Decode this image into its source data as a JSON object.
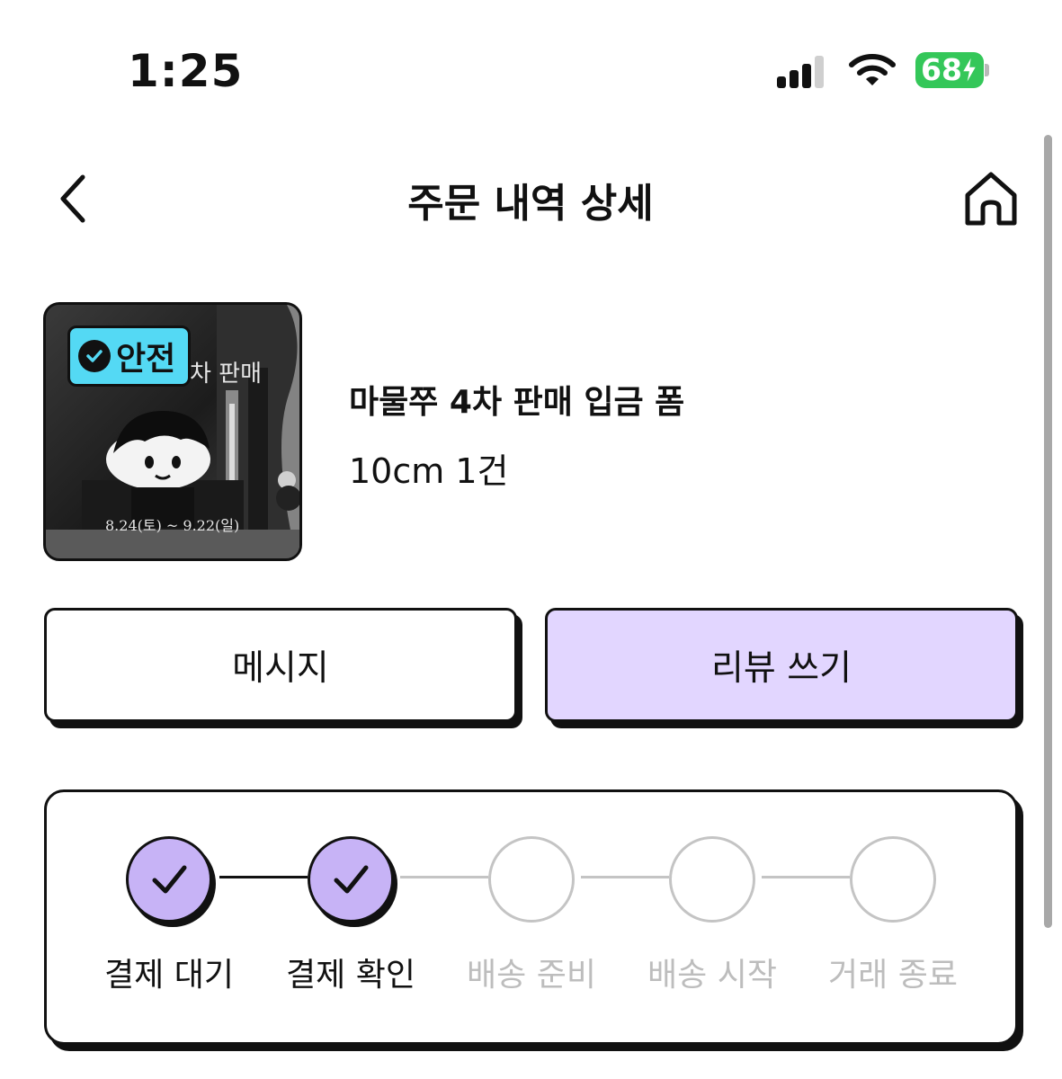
{
  "status_bar": {
    "time": "1:25",
    "battery_level": "68"
  },
  "header": {
    "title": "주문 내역 상세"
  },
  "product": {
    "badge": "안전",
    "image_text_top": "차 판매",
    "image_text_bottom": "8.24(토) ~ 9.22(일)",
    "title": "마물쭈 4차 판매 입금 폼",
    "option": "10cm 1건"
  },
  "actions": {
    "message_label": "메시지",
    "review_label": "리뷰 쓰기"
  },
  "progress": {
    "steps": [
      {
        "label": "결제 대기",
        "done": true
      },
      {
        "label": "결제 확인",
        "done": true
      },
      {
        "label": "배송 준비",
        "done": false
      },
      {
        "label": "배송 시작",
        "done": false
      },
      {
        "label": "거래 종료",
        "done": false
      }
    ]
  },
  "colors": {
    "accent": "#c7b3f6",
    "review_button": "#e2d6ff",
    "safe_badge": "#54d9f4",
    "battery": "#34c759",
    "inactive": "#c4c4c4"
  }
}
